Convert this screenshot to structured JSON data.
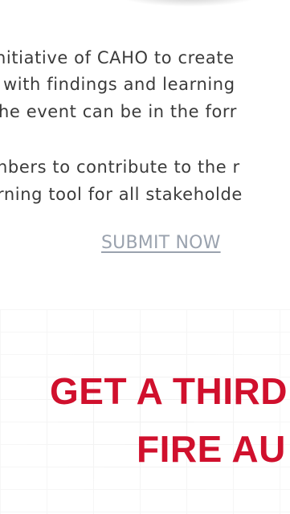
{
  "intro": {
    "lines": [
      "nitiative of CAHO to create",
      "with findings and learning",
      "he event can be in the forr"
    ],
    "lines2": [
      "nbers to contribute to the r",
      "rning tool for all stakeholde"
    ]
  },
  "cta": {
    "submit_label": "SUBMIT NOW"
  },
  "banner": {
    "heading_line1": "GET A THIRD",
    "heading_line2": "FIRE AU"
  },
  "colors": {
    "heading": "#d0102d",
    "link": "#9aa2ae",
    "body_text": "#3b3b3b"
  }
}
